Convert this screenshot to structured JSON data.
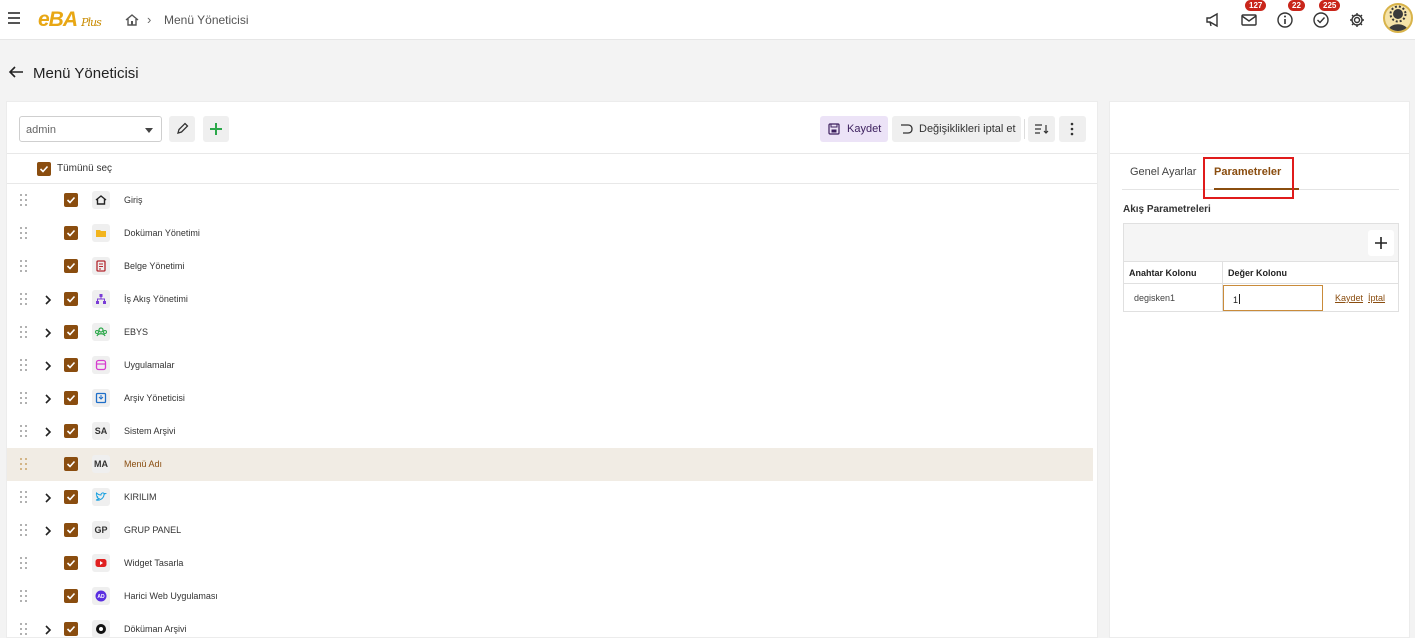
{
  "app": {
    "logo_main": "eBA",
    "logo_sub": "Plus",
    "breadcrumb": "Menü Yöneticisi"
  },
  "header": {
    "mail_badge": "127",
    "info_badge": "22",
    "tasks_badge": "225"
  },
  "page": {
    "title": "Menü Yöneticisi"
  },
  "toolbar": {
    "select_value": "admin",
    "save_label": "Kaydet",
    "cancel_label": "Değişiklikleri iptal et"
  },
  "tree": {
    "select_all_label": "Tümünü seç",
    "items": [
      {
        "label": "Giriş",
        "icon": "home-icon",
        "expandable": false
      },
      {
        "label": "Doküman Yönetimi",
        "icon": "folder-icon",
        "expandable": false
      },
      {
        "label": "Belge Yönetimi",
        "icon": "document-icon",
        "expandable": false
      },
      {
        "label": "İş Akış Yönetimi",
        "icon": "workflow-icon",
        "expandable": true
      },
      {
        "label": "EBYS",
        "icon": "users-icon",
        "expandable": true
      },
      {
        "label": "Uygulamalar",
        "icon": "app-icon",
        "expandable": true
      },
      {
        "label": "Arşiv Yöneticisi",
        "icon": "archive-icon",
        "expandable": true
      },
      {
        "label": "Sistem Arşivi",
        "icon_text": "SA",
        "expandable": true
      },
      {
        "label": "Menü Adı",
        "icon_text": "MA",
        "expandable": false,
        "active": true
      },
      {
        "label": "KIRILIM",
        "icon": "twitter-icon",
        "expandable": true
      },
      {
        "label": "GRUP PANEL",
        "icon_text": "GP",
        "expandable": true
      },
      {
        "label": "Widget Tasarla",
        "icon": "youtube-icon",
        "expandable": false
      },
      {
        "label": "Harici Web Uygulaması",
        "icon": "ad-icon",
        "expandable": false
      },
      {
        "label": "Döküman Arşivi",
        "icon": "circle-icon",
        "expandable": true
      }
    ]
  },
  "right": {
    "tab_general": "Genel Ayarlar",
    "tab_params": "Parametreler",
    "section_title": "Akış Parametreleri",
    "col_key": "Anahtar Kolonu",
    "col_value": "Değer Kolonu",
    "row_key": "degisken1",
    "row_value": "1",
    "save_link": "Kaydet",
    "cancel_link": "İptal"
  },
  "colors": {
    "accent": "#8a4d0f",
    "highlight": "#e01b1b",
    "badge": "#c9261b"
  }
}
